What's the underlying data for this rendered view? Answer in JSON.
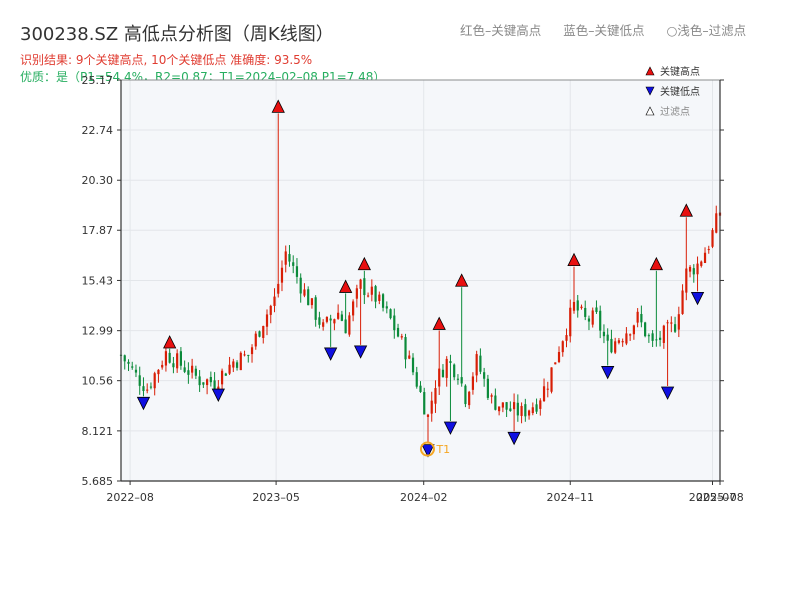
{
  "header": {
    "title": "300238.SZ 高低点分析图（周K线图）",
    "legend_top": [
      "红色–关键高点",
      "蓝色–关键低点",
      "○浅色–过滤点"
    ],
    "subtitle1": "识别结果: 9个关键高点, 10个关键低点   准确度: 93.5%",
    "subtitle2": "优质：是（P1=54.4%，R2=0.87；T1=2024–02–08 P1=7.48）"
  },
  "chart_data": {
    "type": "candlestick",
    "title": "300238.SZ 高低点分析图（周K线图）",
    "ylim": [
      5.685,
      25.17
    ],
    "yticks": [
      5.685,
      8.121,
      10.56,
      12.99,
      15.43,
      17.87,
      20.3,
      22.74,
      25.17
    ],
    "ytick_labels": [
      "5.685",
      "8.121",
      "10.56",
      "12.99",
      "15.43",
      "17.87",
      "20.30",
      "22.74",
      "25.17"
    ],
    "xticks": [
      "2022–08",
      "2023–05",
      "2024–02",
      "2024–11",
      "2025–07",
      "2025–08"
    ],
    "colors": {
      "up": "#d81e06",
      "down": "#0b8a3a",
      "high_marker": "#e81010",
      "low_marker": "#1010e0",
      "filtered": "#ffffff",
      "t1": "#f5a623"
    },
    "legend": [
      "关键高点",
      "关键低点",
      "过滤点"
    ],
    "annotation": "T1",
    "anchors": [
      [
        "2022-07-15",
        11.8
      ],
      [
        "2022-08-12",
        10.8
      ],
      [
        "2022-09-02",
        10.2
      ],
      [
        "2022-10-07",
        11.9
      ],
      [
        "2022-11-11",
        11.2
      ],
      [
        "2022-12-09",
        10.6
      ],
      [
        "2023-01-06",
        10.5
      ],
      [
        "2023-02-10",
        11.5
      ],
      [
        "2023-03-10",
        11.8
      ],
      [
        "2023-04-07",
        13.5
      ],
      [
        "2023-04-28",
        14.5
      ],
      [
        "2023-05-05",
        15.3
      ],
      [
        "2023-05-19",
        16.8
      ],
      [
        "2023-06-16",
        15.2
      ],
      [
        "2023-07-14",
        13.8
      ],
      [
        "2023-07-28",
        13.1
      ],
      [
        "2023-08-25",
        13.9
      ],
      [
        "2023-09-08",
        13.2
      ],
      [
        "2023-10-06",
        15.2
      ],
      [
        "2023-11-03",
        14.6
      ],
      [
        "2023-12-01",
        13.5
      ],
      [
        "2023-12-29",
        12.0
      ],
      [
        "2024-01-19",
        10.5
      ],
      [
        "2024-02-09",
        8.8
      ],
      [
        "2024-02-23",
        10.5
      ],
      [
        "2024-03-15",
        11.5
      ],
      [
        "2024-04-05",
        11.0
      ],
      [
        "2024-04-19",
        9.8
      ],
      [
        "2024-05-10",
        11.5
      ],
      [
        "2024-06-07",
        9.6
      ],
      [
        "2024-07-05",
        9.2
      ],
      [
        "2024-08-02",
        9.0
      ],
      [
        "2024-08-30",
        9.5
      ],
      [
        "2024-09-20",
        10.5
      ],
      [
        "2024-10-11",
        12.2
      ],
      [
        "2024-11-08",
        14.2
      ],
      [
        "2024-11-29",
        13.5
      ],
      [
        "2024-12-20",
        13.6
      ],
      [
        "2025-01-10",
        12.2
      ],
      [
        "2025-02-07",
        12.8
      ],
      [
        "2025-03-07",
        13.6
      ],
      [
        "2025-04-04",
        12.3
      ],
      [
        "2025-04-25",
        12.8
      ],
      [
        "2025-05-16",
        13.3
      ],
      [
        "2025-06-06",
        15.8
      ],
      [
        "2025-06-27",
        16.2
      ],
      [
        "2025-07-18",
        17.2
      ],
      [
        "2025-08-08",
        18.8
      ]
    ],
    "key_highs": [
      {
        "date": "2022-10-14",
        "price": 12.1
      },
      {
        "date": "2023-05-05",
        "price": 23.55
      },
      {
        "date": "2023-09-08",
        "price": 14.8
      },
      {
        "date": "2023-10-13",
        "price": 15.9
      },
      {
        "date": "2024-03-01",
        "price": 13.0
      },
      {
        "date": "2024-04-12",
        "price": 15.1
      },
      {
        "date": "2024-11-08",
        "price": 16.1
      },
      {
        "date": "2025-04-11",
        "price": 15.9
      },
      {
        "date": "2025-06-06",
        "price": 18.5
      }
    ],
    "key_lows": [
      {
        "date": "2022-08-26",
        "price": 9.8
      },
      {
        "date": "2023-01-13",
        "price": 10.2
      },
      {
        "date": "2023-08-11",
        "price": 12.2
      },
      {
        "date": "2023-10-06",
        "price": 12.3
      },
      {
        "date": "2024-02-09",
        "price": 7.5
      },
      {
        "date": "2024-03-22",
        "price": 8.6
      },
      {
        "date": "2024-07-19",
        "price": 8.1
      },
      {
        "date": "2025-01-10",
        "price": 11.3
      },
      {
        "date": "2025-05-02",
        "price": 10.3
      },
      {
        "date": "2025-06-27",
        "price": 14.9
      }
    ],
    "t1": {
      "date": "2024-02-08",
      "price": 7.48
    }
  }
}
